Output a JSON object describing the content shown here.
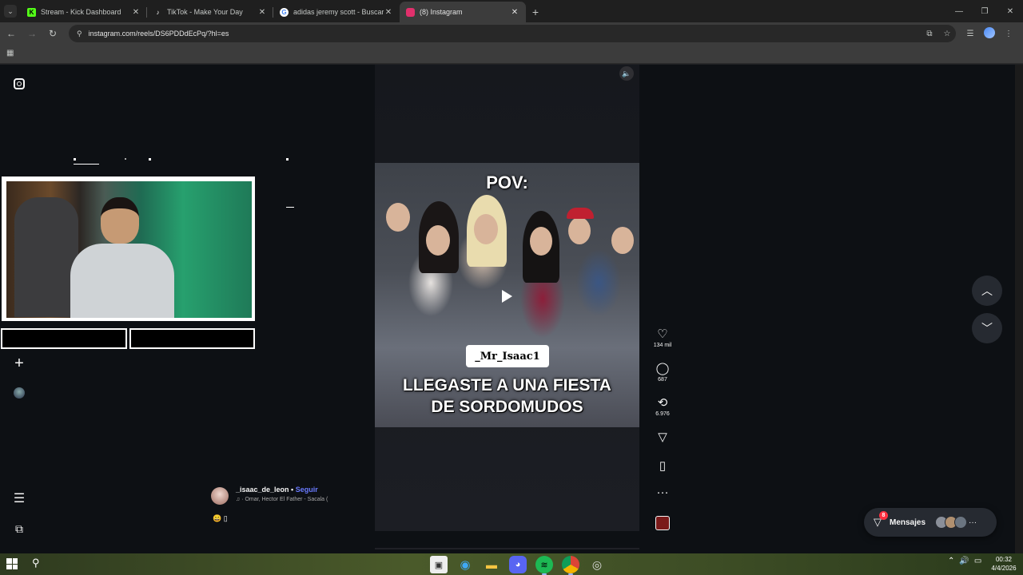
{
  "browser": {
    "tabs": [
      {
        "title": "Stream - Kick Dashboard",
        "icon": "kick-icon",
        "color": "#53fc18",
        "active": false
      },
      {
        "title": "TikTok - Make Your Day",
        "icon": "tiktok-icon",
        "color": "#ffffff",
        "active": false
      },
      {
        "title": "adidas jeremy scott - Buscar co",
        "icon": "google-icon",
        "color": "#4285f4",
        "active": false
      },
      {
        "title": "(8) Instagram",
        "icon": "instagram-icon",
        "color": "#e1306c",
        "active": true
      }
    ],
    "url": "instagram.com/reels/DS6PDDdEcPq/?hl=es"
  },
  "reel": {
    "pov_text": "POV:",
    "tag_text": "_Mr_Isaac1",
    "caption_line1": "LLEGASTE A UNA FIESTA",
    "caption_line2": "DE SORDOMUDOS",
    "author_name": "_isaac_de_leon",
    "follow_sep": " • ",
    "follow_label": "Seguir",
    "music": "Omar, Hector El Father - Sacala (",
    "music_icon": "music-note-icon",
    "emoji_text": "😄 ▯"
  },
  "actions": {
    "likes": "134 mil",
    "comments": "687",
    "reposts": "6.976"
  },
  "messages": {
    "label": "Mensajes",
    "badge": "8"
  },
  "taskbar": {
    "time": "00:32",
    "date": "4/4/2026"
  },
  "colors": {
    "page_bg": "#0d1014",
    "follow_link": "#6a7bff",
    "badge": "#ff3040"
  }
}
